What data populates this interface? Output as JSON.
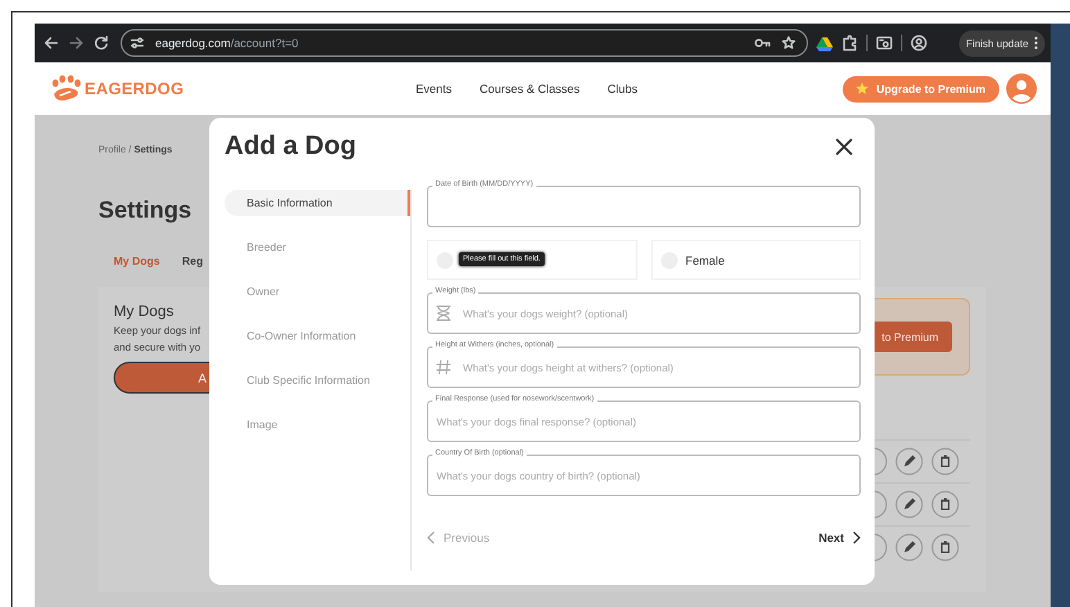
{
  "browser": {
    "url_domain": "eagerdog.com",
    "url_path": "/account?t=0",
    "update_button": "Finish update"
  },
  "header": {
    "logo": "EAGERDOG",
    "nav": [
      {
        "label": "Events"
      },
      {
        "label": "Courses & Classes"
      },
      {
        "label": "Clubs"
      }
    ],
    "upgrade_button": "Upgrade to Premium"
  },
  "page": {
    "breadcrumb": "Profile / **Settings**",
    "title": "Settings",
    "tabs": [
      {
        "label": "My Dogs",
        "selected": true
      },
      {
        "label": "Reg",
        "selected": false
      }
    ],
    "card": {
      "title": "My Dogs",
      "text_lines": [
        "Keep your dogs inf",
        "and secure with yo"
      ],
      "add_button": "A"
    },
    "promo_button": "to Premium"
  },
  "modal": {
    "title": "Add a Dog",
    "steps": [
      {
        "label": "Basic Information",
        "selected": true
      },
      {
        "label": "Breeder",
        "selected": false
      },
      {
        "label": "Owner",
        "selected": false
      },
      {
        "label": "Co-Owner Information",
        "selected": false
      },
      {
        "label": "Club Specific Information",
        "selected": false
      },
      {
        "label": "Image",
        "selected": false
      }
    ],
    "fields": [
      {
        "kind": "plain",
        "label": "Date of Birth (MM/DD/YYYY)"
      },
      {
        "kind": "radio",
        "options": [
          {
            "tooltip": "Please fill out this field.",
            "selected": false
          },
          {
            "label": "Female",
            "selected": false
          }
        ]
      },
      {
        "kind": "weight",
        "label": "Weight (lbs)",
        "placeholder": "What's your dogs weight? (optional)"
      },
      {
        "kind": "height",
        "label": "Height at Withers (inches, optional)",
        "placeholder": "What's your dogs height at withers? (optional)"
      },
      {
        "kind": "plain",
        "label": "Final Response (used for nosework/scentwork)",
        "placeholder": "What's your dogs final response? (optional)"
      },
      {
        "kind": "plain",
        "label": "Country Of Birth (optional)",
        "placeholder": "What's your dogs country of birth? (optional)"
      }
    ],
    "previous": {
      "label": "Previous",
      "disabled": true
    },
    "next": {
      "label": "Next",
      "disabled": false
    }
  }
}
